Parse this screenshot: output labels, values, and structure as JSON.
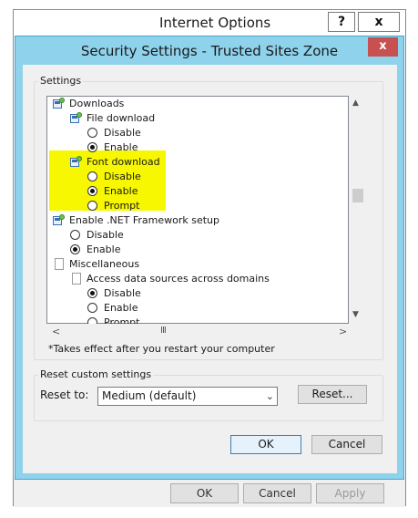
{
  "internet_options": {
    "title": "Internet Options",
    "help_label": "?",
    "close_label": "x",
    "buttons": [
      "OK",
      "Cancel",
      "Apply"
    ]
  },
  "dialog": {
    "title": "Security Settings - Trusted Sites Zone",
    "close_label": "x",
    "settings_group": "Settings",
    "items": [
      {
        "type": "category",
        "label": "Downloads"
      },
      {
        "type": "setting",
        "label": "File download"
      },
      {
        "type": "radio",
        "label": "Disable",
        "checked": false
      },
      {
        "type": "radio",
        "label": "Enable",
        "checked": true
      },
      {
        "type": "setting",
        "label": "Font download"
      },
      {
        "type": "radio",
        "label": "Disable",
        "checked": false
      },
      {
        "type": "radio",
        "label": "Enable",
        "checked": true
      },
      {
        "type": "radio",
        "label": "Prompt",
        "checked": false
      },
      {
        "type": "setting",
        "label": "Enable .NET Framework setup"
      },
      {
        "type": "radio",
        "label": "Disable",
        "checked": false
      },
      {
        "type": "radio",
        "label": "Enable",
        "checked": true
      },
      {
        "type": "category",
        "label": "Miscellaneous"
      },
      {
        "type": "subsetting",
        "label": "Access data sources across domains"
      },
      {
        "type": "radio",
        "label": "Disable",
        "checked": true
      },
      {
        "type": "radio",
        "label": "Enable",
        "checked": false
      },
      {
        "type": "radio",
        "label": "Prompt",
        "checked": false
      }
    ],
    "restart_note": "*Takes effect after you restart your computer",
    "reset_group": "Reset custom settings",
    "reset_to_label": "Reset to:",
    "reset_value": "Medium (default)",
    "reset_button": "Reset...",
    "ok": "OK",
    "cancel": "Cancel",
    "highlight_color": "#f6f700",
    "titlebar_color": "#8fd2ec",
    "close_color": "#c75050"
  }
}
